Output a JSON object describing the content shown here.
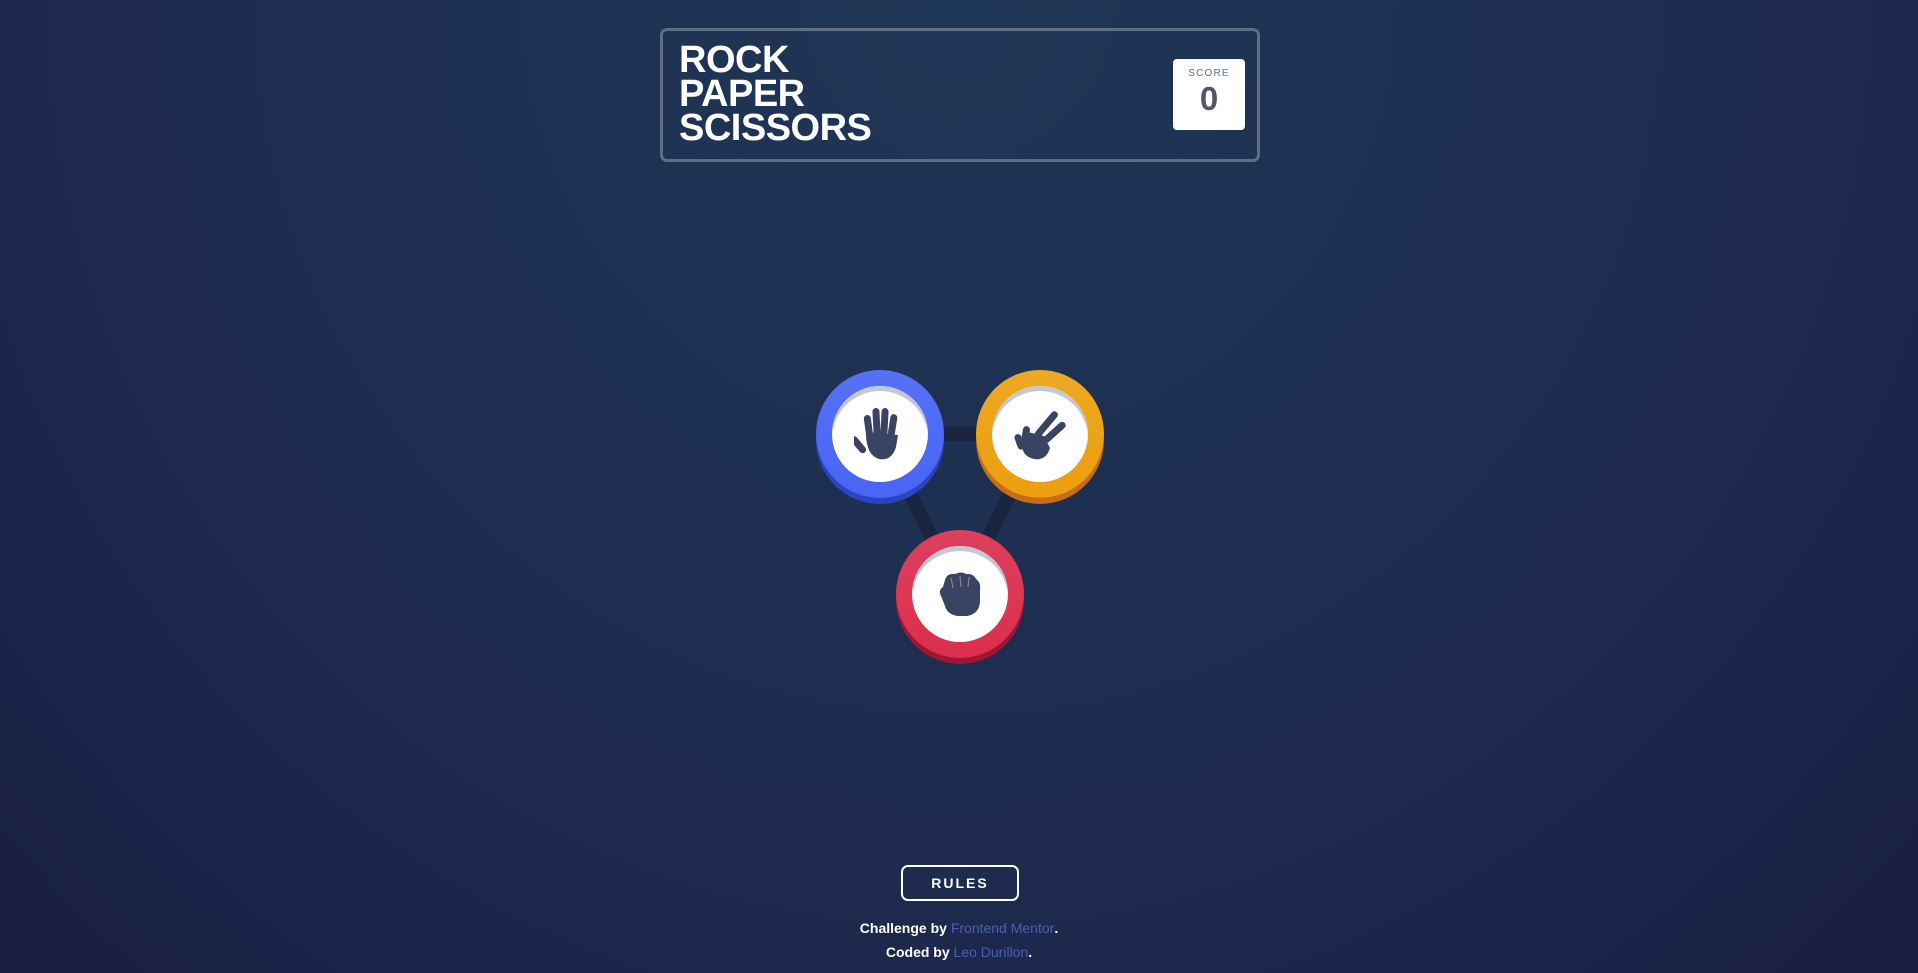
{
  "header": {
    "title_lines": [
      "ROCK",
      "PAPER",
      "SCISSORS"
    ],
    "score_label": "SCORE",
    "score_value": "0"
  },
  "tokens": [
    {
      "choice": "paper",
      "icon": "paper-hand-icon",
      "color": "#4865f4"
    },
    {
      "choice": "scissors",
      "icon": "scissors-hand-icon",
      "color": "#ec9e0e"
    },
    {
      "choice": "rock",
      "icon": "rock-fist-icon",
      "color": "#dc2e4e"
    }
  ],
  "footer": {
    "rules_label": "RULES",
    "challenge_prefix": "Challenge by ",
    "challenge_link": "Frontend Mentor",
    "challenge_suffix": ".",
    "coded_prefix": "Coded by ",
    "coded_link": "Leo Durillon",
    "coded_suffix": "."
  },
  "colors": {
    "background": "#1f3756",
    "header_border": "#606e85",
    "link": "#4a5fb4"
  }
}
